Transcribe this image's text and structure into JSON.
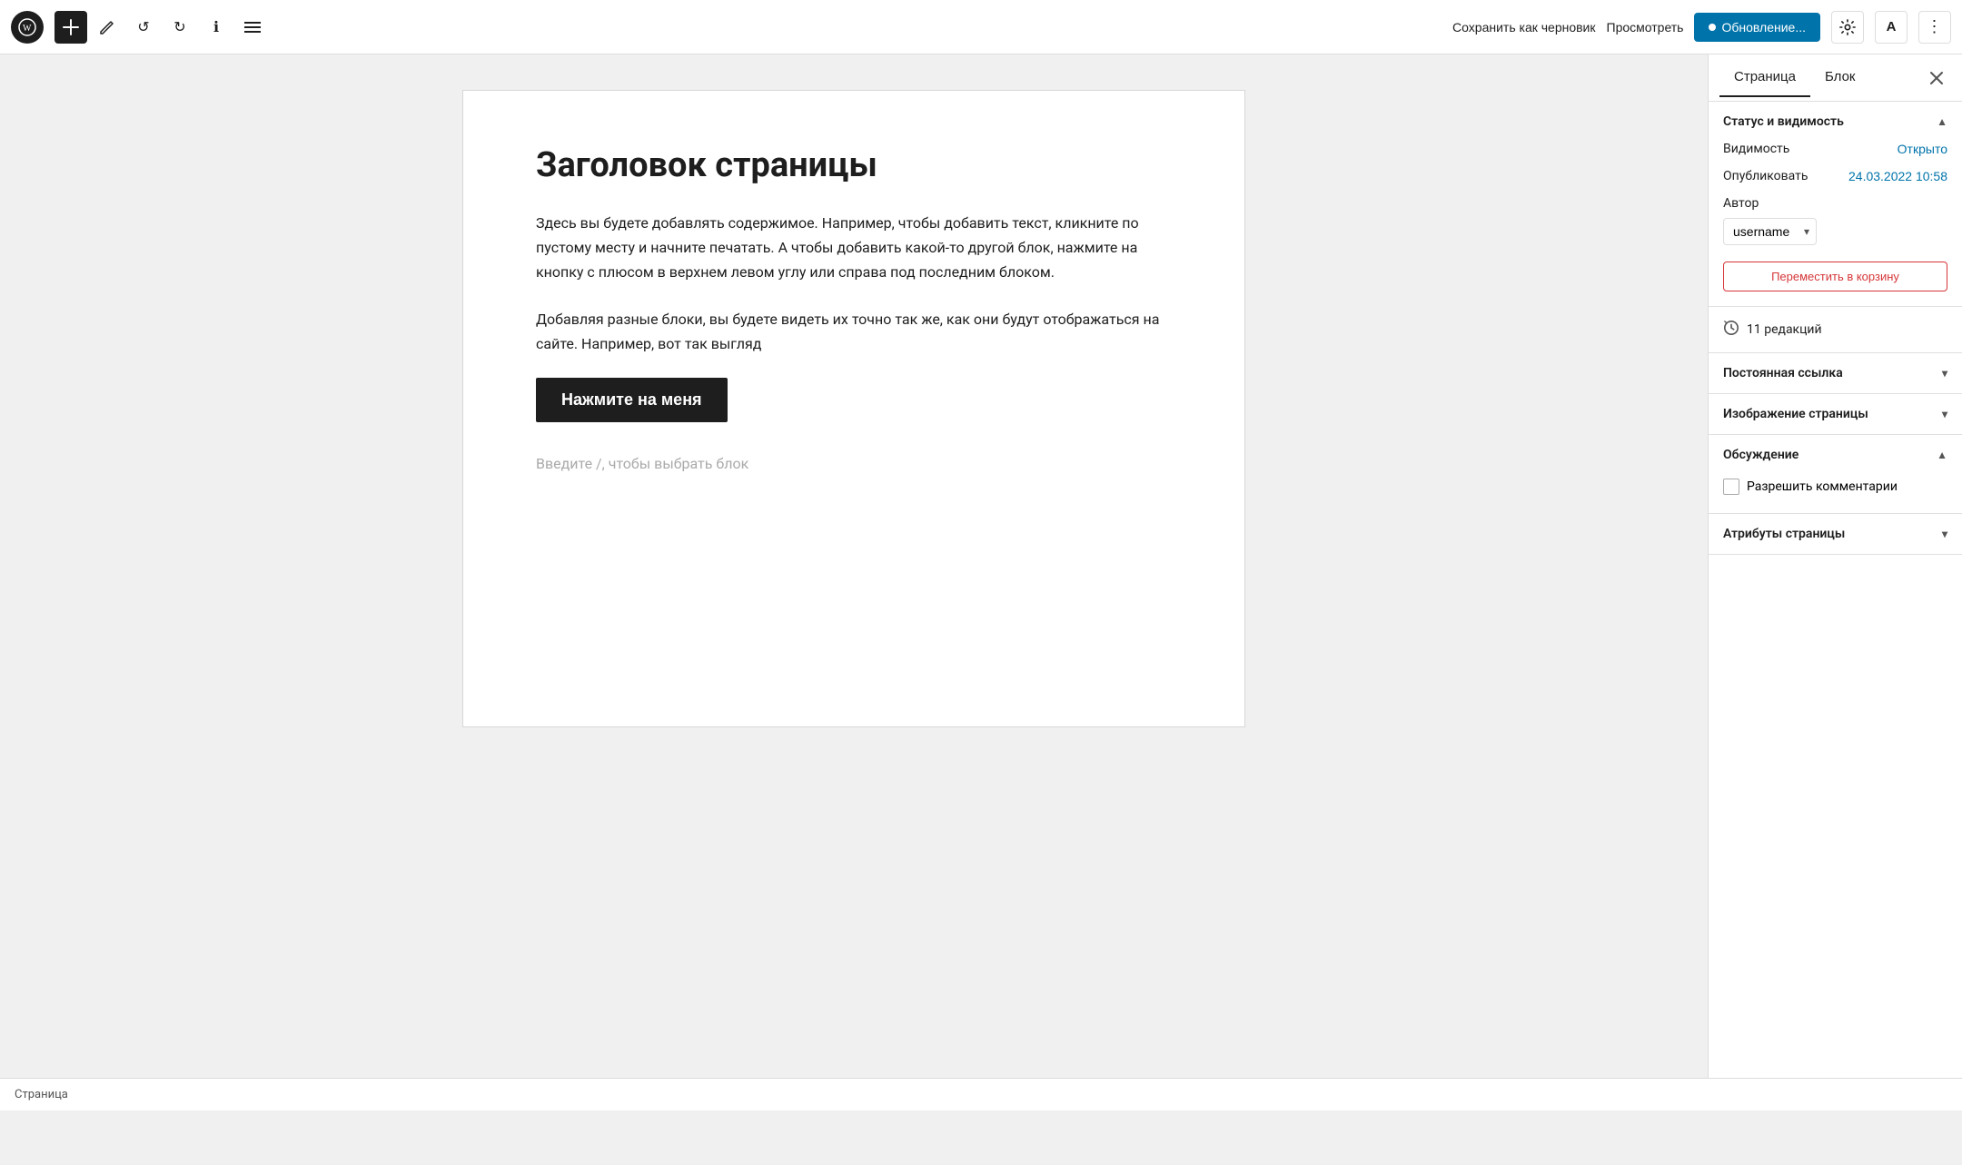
{
  "toolbar": {
    "add_label": "+",
    "undo_label": "↺",
    "redo_label": "↻",
    "info_label": "ℹ",
    "list_label": "☰",
    "save_draft_label": "Сохранить как черновик",
    "preview_label": "Просмотреть",
    "update_label": "Обновление...",
    "gear_label": "⚙",
    "user_label": "A",
    "more_label": "⋮"
  },
  "editor": {
    "page_title": "Заголовок страницы",
    "body_paragraph1": "Здесь вы будете добавлять содержимое. Например, чтобы добавить текст, кликните по пустому месту и начните печатать. А чтобы добавить какой-то другой блок, нажмите на кнопку с плюсом в верхнем левом углу или справа под последним блоком.",
    "body_paragraph2": "Добавляя разные блоки, вы будете видеть их точно так же, как они будут отображаться на сайте. Например, вот так выгляд",
    "button_label": "Нажмите на меня",
    "placeholder_text": "Введите /, чтобы выбрать блок"
  },
  "sidebar": {
    "tab_page": "Страница",
    "tab_block": "Блок",
    "sections": {
      "status_visibility": {
        "title": "Статус и видимость",
        "expanded": true,
        "visibility_label": "Видимость",
        "visibility_value": "Открыто",
        "publish_label": "Опубликовать",
        "publish_value": "24.03.2022 10:58",
        "author_label": "Автор",
        "author_value": "username",
        "trash_label": "Переместить в корзину"
      },
      "revisions": {
        "count": "11 редакций"
      },
      "permalink": {
        "title": "Постоянная ссылка",
        "expanded": false
      },
      "page_image": {
        "title": "Изображение страницы",
        "expanded": false
      },
      "discussion": {
        "title": "Обсуждение",
        "expanded": true,
        "allow_comments_label": "Разрешить комментарии",
        "allow_comments_checked": false
      },
      "page_attributes": {
        "title": "Атрибуты страницы",
        "expanded": false
      }
    }
  },
  "status_bar": {
    "label": "Страница"
  }
}
